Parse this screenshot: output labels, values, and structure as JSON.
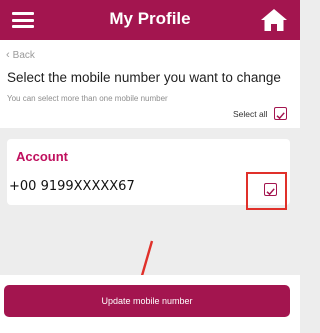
{
  "header": {
    "title": "My Profile",
    "menu_icon": "hamburger-menu-icon",
    "home_icon": "home-icon",
    "color": "#a3154f"
  },
  "nav": {
    "back_label": "Back"
  },
  "page": {
    "heading": "Select the mobile number you want to change",
    "subtitle": "You can select more than one mobile number",
    "select_all_label": "Select all",
    "select_all_checked": true
  },
  "account": {
    "title": "Account",
    "numbers": [
      {
        "number": "+00 9199XXXXX67",
        "checked": true
      }
    ]
  },
  "actions": {
    "update_label": "Update mobile number"
  },
  "annotations": {
    "highlight_color": "#e0302a"
  }
}
